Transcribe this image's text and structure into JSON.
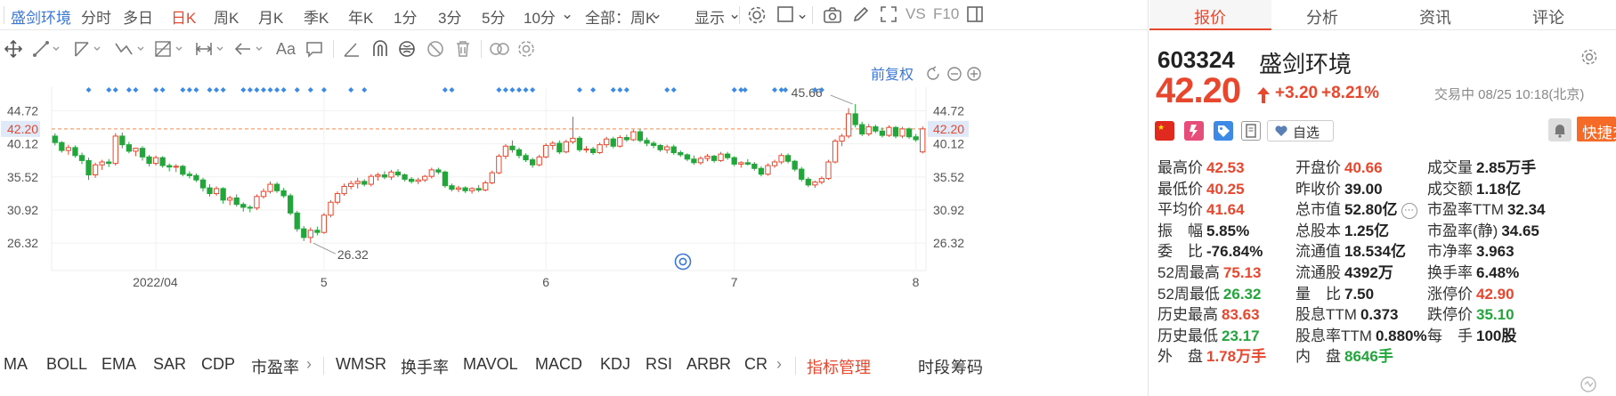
{
  "topbar": {
    "stock_name": "盛剑环境",
    "periods": [
      "分时",
      "多日",
      "日K",
      "周K",
      "月K",
      "季K",
      "年K",
      "1分",
      "3分",
      "5分",
      "10分"
    ],
    "active_period": "日K",
    "range_select": "全部：周K",
    "display_label": "显示",
    "vs_label": "VS",
    "f10_label": "F10"
  },
  "toolbar": {
    "text_tool": "Aa"
  },
  "chart": {
    "adjust_label": "前复权",
    "current_price_label": "42.20",
    "price_high_annotation": "45.66",
    "price_low_annotation": "26.32",
    "y_ticks": [
      "44.72",
      "40.12",
      "35.52",
      "30.92",
      "26.32"
    ],
    "x_labels": [
      "2022/04",
      "5",
      "6",
      "7",
      "8"
    ],
    "colors": {
      "up": "#e8472e",
      "down": "#22a63b",
      "price_line": "#f58a4b",
      "marker": "#3b8ae6"
    }
  },
  "indicators": {
    "left": [
      "MA",
      "BOLL",
      "EMA",
      "SAR",
      "CDP",
      "市盈率"
    ],
    "right": [
      "WMSR",
      "换手率",
      "MAVOL",
      "MACD",
      "KDJ",
      "RSI",
      "ARBR",
      "CR"
    ],
    "manage": "指标管理",
    "extra": [
      "时段",
      "筹码"
    ]
  },
  "right_tabs": [
    "报价",
    "分析",
    "资讯",
    "评论"
  ],
  "quote": {
    "code": "603324",
    "name": "盛剑环境",
    "price": "42.20",
    "change": "+3.20",
    "change_pct": "+8.21%",
    "status": "交易中 08/25 10:18(北京)",
    "watchlist": "自选",
    "quick_trade": "快捷交易",
    "rows": [
      [
        {
          "label": "最高价",
          "value": "42.53",
          "color": "red"
        },
        {
          "label": "开盘价",
          "value": "40.66",
          "color": "red"
        },
        {
          "label": "成交量",
          "value": "2.85万手",
          "color": "blk"
        }
      ],
      [
        {
          "label": "最低价",
          "value": "40.25",
          "color": "red"
        },
        {
          "label": "昨收价",
          "value": "39.00",
          "color": "blk"
        },
        {
          "label": "成交额",
          "value": "1.18亿",
          "color": "blk"
        }
      ],
      [
        {
          "label": "平均价",
          "value": "41.64",
          "color": "red"
        },
        {
          "label": "总市值",
          "value": "52.80亿",
          "color": "blk"
        },
        {
          "label": "市盈率TTM",
          "value": "32.34",
          "color": "blk"
        }
      ],
      [
        {
          "label": "振　幅",
          "value": "5.85%",
          "color": "blk"
        },
        {
          "label": "总股本",
          "value": "1.25亿",
          "color": "blk"
        },
        {
          "label": "市盈率(静)",
          "value": "34.65",
          "color": "blk"
        }
      ],
      [
        {
          "label": "委　比",
          "value": "-76.84%",
          "color": "blk"
        },
        {
          "label": "流通值",
          "value": "18.534亿",
          "color": "blk"
        },
        {
          "label": "市净率",
          "value": "3.963",
          "color": "blk"
        }
      ],
      [
        {
          "label": "52周最高",
          "value": "75.13",
          "color": "red"
        },
        {
          "label": "流通股",
          "value": "4392万",
          "color": "blk"
        },
        {
          "label": "换手率",
          "value": "6.48%",
          "color": "blk"
        }
      ],
      [
        {
          "label": "52周最低",
          "value": "26.32",
          "color": "green"
        },
        {
          "label": "量　比",
          "value": "7.50",
          "color": "blk"
        },
        {
          "label": "涨停价",
          "value": "42.90",
          "color": "red"
        }
      ],
      [
        {
          "label": "历史最高",
          "value": "83.63",
          "color": "red"
        },
        {
          "label": "股息TTM",
          "value": "0.373",
          "color": "blk"
        },
        {
          "label": "跌停价",
          "value": "35.10",
          "color": "green"
        }
      ],
      [
        {
          "label": "历史最低",
          "value": "23.17",
          "color": "green"
        },
        {
          "label": "股息率TTM",
          "value": "0.880%",
          "color": "blk"
        },
        {
          "label": "每　手",
          "value": "100股",
          "color": "blk"
        }
      ],
      [
        {
          "label": "外　盘",
          "value": "1.78万手",
          "color": "red"
        },
        {
          "label": "内　盘",
          "value": "8646手",
          "color": "green"
        },
        null
      ]
    ]
  },
  "chart_data": {
    "type": "candlestick",
    "title": "",
    "ylim": [
      22.5,
      48.0
    ],
    "y_ticks": [
      44.72,
      40.12,
      35.52,
      30.92,
      26.32
    ],
    "current_price": 42.2,
    "annotations": [
      {
        "text": "45.66"
      },
      {
        "text": "26.32"
      }
    ],
    "ohlc": [
      [
        41.2,
        41.6,
        39.9,
        40.3
      ],
      [
        40.3,
        40.5,
        38.9,
        39.2
      ],
      [
        39.2,
        40.0,
        38.6,
        39.6
      ],
      [
        39.6,
        39.9,
        38.2,
        38.5
      ],
      [
        38.5,
        38.9,
        37.3,
        37.8
      ],
      [
        37.8,
        38.2,
        35.1,
        35.8
      ],
      [
        35.8,
        37.5,
        35.4,
        37.2
      ],
      [
        37.2,
        37.9,
        36.5,
        37.6
      ],
      [
        37.6,
        38.0,
        36.9,
        37.4
      ],
      [
        37.4,
        41.6,
        37.1,
        41.2
      ],
      [
        41.2,
        41.7,
        39.5,
        40.0
      ],
      [
        40.0,
        40.4,
        38.8,
        39.1
      ],
      [
        39.1,
        39.6,
        38.4,
        39.5
      ],
      [
        39.5,
        39.8,
        37.8,
        38.3
      ],
      [
        38.3,
        38.6,
        37.0,
        37.4
      ],
      [
        37.4,
        38.5,
        37.1,
        38.2
      ],
      [
        38.2,
        38.4,
        36.8,
        37.1
      ],
      [
        37.1,
        37.4,
        36.3,
        36.9
      ],
      [
        36.9,
        37.3,
        36.2,
        37.0
      ],
      [
        37.0,
        37.2,
        35.6,
        35.9
      ],
      [
        35.9,
        36.3,
        35.3,
        35.7
      ],
      [
        35.7,
        36.0,
        34.8,
        35.1
      ],
      [
        35.1,
        35.4,
        33.5,
        34.0
      ],
      [
        34.0,
        34.5,
        32.8,
        33.2
      ],
      [
        33.2,
        34.2,
        32.9,
        33.9
      ],
      [
        33.9,
        34.1,
        31.8,
        32.3
      ],
      [
        32.3,
        32.9,
        31.6,
        32.6
      ],
      [
        32.6,
        33.1,
        31.4,
        31.7
      ],
      [
        31.7,
        32.0,
        30.7,
        31.3
      ],
      [
        31.3,
        31.6,
        30.6,
        31.2
      ],
      [
        31.2,
        33.1,
        30.9,
        32.8
      ],
      [
        32.8,
        33.9,
        32.5,
        33.5
      ],
      [
        33.5,
        34.9,
        33.2,
        34.5
      ],
      [
        34.5,
        34.8,
        33.3,
        33.6
      ],
      [
        33.6,
        34.0,
        32.6,
        32.9
      ],
      [
        32.9,
        33.2,
        30.2,
        30.5
      ],
      [
        30.5,
        30.8,
        27.9,
        28.3
      ],
      [
        28.3,
        28.7,
        26.6,
        27.1
      ],
      [
        27.1,
        28.5,
        26.32,
        28.1
      ],
      [
        28.1,
        28.6,
        27.4,
        27.8
      ],
      [
        27.8,
        30.5,
        27.6,
        30.2
      ],
      [
        30.2,
        32.3,
        29.9,
        32.0
      ],
      [
        32.0,
        33.5,
        31.7,
        33.2
      ],
      [
        33.2,
        34.6,
        32.9,
        34.2
      ],
      [
        34.2,
        35.0,
        33.8,
        34.6
      ],
      [
        34.6,
        35.4,
        33.9,
        34.9
      ],
      [
        34.9,
        35.2,
        34.2,
        34.5
      ],
      [
        34.5,
        35.9,
        34.2,
        35.6
      ],
      [
        35.6,
        36.1,
        35.0,
        35.8
      ],
      [
        35.8,
        36.3,
        35.2,
        35.5
      ],
      [
        35.5,
        36.5,
        35.1,
        36.2
      ],
      [
        36.2,
        36.6,
        35.5,
        35.8
      ],
      [
        35.8,
        36.0,
        34.9,
        35.2
      ],
      [
        35.2,
        35.5,
        34.6,
        34.9
      ],
      [
        34.9,
        35.4,
        34.5,
        35.1
      ],
      [
        35.1,
        35.8,
        34.8,
        35.6
      ],
      [
        35.6,
        36.8,
        35.3,
        36.5
      ],
      [
        36.5,
        36.8,
        35.9,
        36.2
      ],
      [
        36.2,
        36.4,
        34.0,
        34.3
      ],
      [
        34.3,
        34.6,
        33.5,
        33.8
      ],
      [
        33.8,
        34.3,
        33.4,
        34.0
      ],
      [
        34.0,
        34.2,
        33.3,
        33.6
      ],
      [
        33.6,
        34.1,
        33.2,
        33.9
      ],
      [
        33.9,
        34.4,
        33.4,
        33.7
      ],
      [
        33.7,
        35.0,
        33.5,
        34.7
      ],
      [
        34.7,
        36.4,
        34.5,
        36.1
      ],
      [
        36.1,
        38.7,
        35.9,
        38.4
      ],
      [
        38.4,
        40.1,
        38.0,
        39.8
      ],
      [
        39.8,
        40.6,
        38.9,
        39.3
      ],
      [
        39.3,
        39.6,
        38.1,
        38.5
      ],
      [
        38.5,
        38.8,
        37.6,
        37.9
      ],
      [
        37.9,
        38.2,
        36.8,
        37.2
      ],
      [
        37.2,
        38.6,
        37.0,
        38.3
      ],
      [
        38.3,
        40.2,
        38.1,
        39.9
      ],
      [
        39.9,
        40.5,
        39.3,
        40.2
      ],
      [
        40.2,
        40.6,
        38.7,
        39.0
      ],
      [
        39.0,
        40.7,
        38.8,
        40.4
      ],
      [
        40.4,
        43.9,
        40.1,
        40.9
      ],
      [
        40.9,
        41.2,
        39.0,
        39.3
      ],
      [
        39.3,
        39.8,
        38.9,
        39.4
      ],
      [
        39.4,
        39.7,
        38.6,
        38.9
      ],
      [
        38.9,
        40.3,
        38.7,
        40.0
      ],
      [
        40.0,
        41.1,
        39.6,
        40.8
      ],
      [
        40.8,
        41.1,
        39.5,
        39.8
      ],
      [
        39.8,
        41.3,
        39.6,
        41.0
      ],
      [
        41.0,
        41.4,
        40.4,
        40.7
      ],
      [
        40.7,
        42.1,
        40.5,
        41.8
      ],
      [
        41.8,
        42.2,
        40.3,
        40.6
      ],
      [
        40.6,
        41.0,
        39.8,
        40.2
      ],
      [
        40.2,
        40.5,
        39.5,
        39.9
      ],
      [
        39.9,
        40.1,
        39.0,
        39.3
      ],
      [
        39.3,
        40.0,
        38.8,
        39.7
      ],
      [
        39.7,
        40.0,
        38.6,
        38.9
      ],
      [
        38.9,
        39.2,
        38.3,
        38.6
      ],
      [
        38.6,
        38.8,
        37.7,
        38.0
      ],
      [
        38.0,
        38.5,
        37.2,
        37.5
      ],
      [
        37.5,
        38.4,
        37.2,
        38.1
      ],
      [
        38.1,
        38.7,
        37.7,
        38.4
      ],
      [
        38.4,
        38.6,
        37.5,
        37.8
      ],
      [
        37.8,
        39.0,
        37.6,
        38.7
      ],
      [
        38.7,
        39.0,
        37.9,
        38.2
      ],
      [
        38.2,
        38.4,
        37.0,
        37.3
      ],
      [
        37.3,
        37.7,
        36.8,
        37.5
      ],
      [
        37.5,
        38.0,
        37.1,
        37.3
      ],
      [
        37.3,
        37.6,
        36.4,
        36.7
      ],
      [
        36.7,
        37.0,
        35.6,
        35.9
      ],
      [
        35.9,
        37.4,
        35.7,
        37.1
      ],
      [
        37.1,
        37.9,
        36.8,
        37.6
      ],
      [
        37.6,
        38.8,
        37.3,
        38.5
      ],
      [
        38.5,
        38.8,
        37.4,
        37.7
      ],
      [
        37.7,
        37.9,
        36.3,
        36.6
      ],
      [
        36.6,
        36.9,
        34.9,
        35.2
      ],
      [
        35.2,
        35.5,
        34.1,
        34.4
      ],
      [
        34.4,
        35.0,
        34.0,
        34.8
      ],
      [
        34.8,
        35.6,
        34.5,
        35.3
      ],
      [
        35.3,
        37.9,
        35.1,
        37.6
      ],
      [
        37.6,
        40.8,
        37.4,
        40.5
      ],
      [
        40.5,
        41.5,
        39.8,
        41.2
      ],
      [
        41.2,
        45.1,
        40.9,
        44.3
      ],
      [
        44.3,
        45.66,
        42.4,
        42.8
      ],
      [
        42.8,
        43.2,
        41.2,
        41.5
      ],
      [
        41.5,
        42.9,
        41.2,
        42.5
      ],
      [
        42.5,
        42.8,
        41.6,
        41.9
      ],
      [
        41.9,
        42.4,
        41.0,
        41.3
      ],
      [
        41.3,
        42.7,
        41.1,
        42.4
      ],
      [
        42.4,
        42.6,
        40.9,
        41.2
      ],
      [
        41.2,
        42.5,
        40.9,
        42.2
      ],
      [
        42.2,
        42.4,
        40.8,
        41.1
      ],
      [
        41.1,
        41.5,
        40.4,
        40.7
      ],
      [
        39.0,
        42.53,
        38.8,
        42.2
      ]
    ]
  }
}
